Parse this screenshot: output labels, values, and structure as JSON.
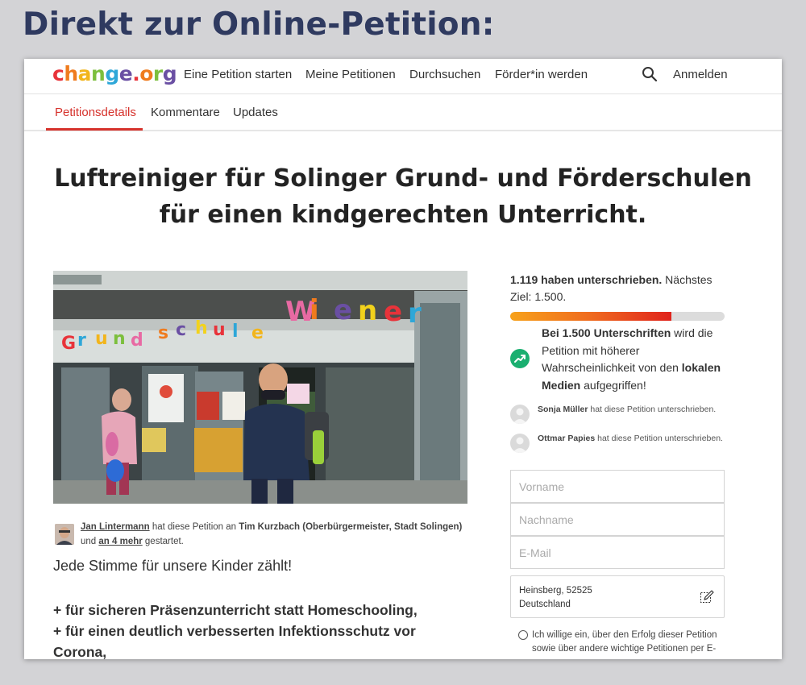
{
  "outer_heading": "Direkt zur Online-Petition:",
  "logo": {
    "parts": [
      "c",
      "h",
      "a",
      "n",
      "g",
      "e",
      ".",
      "o",
      "r",
      "g"
    ],
    "colors": [
      "#e8333a",
      "#ef7b1e",
      "#f2b51c",
      "#7cbf3d",
      "#2ea7d8",
      "#6a4fa3",
      "#e8333a",
      "#ef7b1e",
      "#7cbf3d",
      "#6a4fa3"
    ]
  },
  "nav": {
    "start": "Eine Petition starten",
    "mine": "Meine Petitionen",
    "browse": "Durchsuchen",
    "member": "Förder*in werden",
    "login": "Anmelden"
  },
  "tabs": {
    "details": "Petitionsdetails",
    "comments": "Kommentare",
    "updates": "Updates"
  },
  "petition": {
    "title_line1": "Luftreiniger für Solinger Grund- und Förderschulen",
    "title_line2": "für einen kindgerechten Unterricht."
  },
  "photo": {
    "sign_text": [
      "G",
      "r",
      "u",
      "n",
      "d",
      "s",
      "c",
      "h",
      "u",
      "l",
      "e",
      " ",
      "W",
      "i",
      "e",
      "n",
      "e",
      "r"
    ]
  },
  "author": {
    "name": "Jan Lintermann",
    "text1": " hat diese Petition an ",
    "recipient": "Tim Kurzbach (Oberbürgermeister, Stadt Solingen)",
    "text2": "und ",
    "more": "an 4 mehr",
    "text3": " gestartet."
  },
  "body": {
    "lead": "Jede Stimme für unsere Kinder zählt!",
    "bullet1": "+ für sicheren Präsenzunterricht statt Homeschooling,",
    "bullet2": "+ für einen deutlich verbesserten Infektionsschutz vor",
    "bullet3": "Corona,"
  },
  "signatures": {
    "count_bold": "1.119 haben unterschrieben.",
    "next_goal": " Nächstes Ziel: 1.500.",
    "progress": 0.75
  },
  "goal": {
    "b1": "Bei 1.500 Unterschriften",
    "t1": " wird die Petition mit höherer Wahrscheinlichkeit von den ",
    "b2": "lokalen Medien",
    "t2": " aufgegriffen!"
  },
  "signers": [
    {
      "name": "Sonja Müller",
      "text": " hat diese Petition unterschrieben."
    },
    {
      "name": "Ottmar Papies",
      "text": " hat diese Petition unterschrieben."
    }
  ],
  "form": {
    "first_name_placeholder": "Vorname",
    "last_name_placeholder": "Nachname",
    "email_placeholder": "E-Mail",
    "location_line1": "Heinsberg, 52525",
    "location_line2": "Deutschland",
    "consent": "Ich willige ein, über den Erfolg dieser Petition sowie über andere wichtige Petitionen per E-"
  }
}
